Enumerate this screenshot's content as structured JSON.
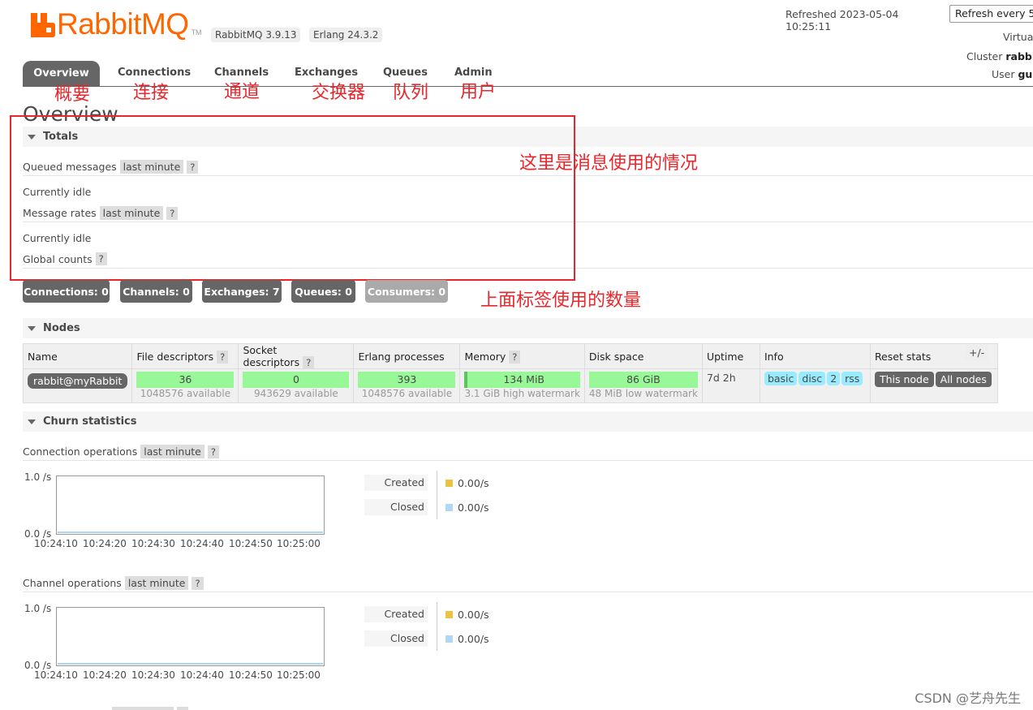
{
  "header": {
    "logo_text": "RabbitMQ",
    "logo_tm": "TM",
    "rabbitmq_version": "RabbitMQ 3.9.13",
    "erlang_version": "Erlang 24.3.2",
    "refreshed": "Refreshed 2023-05-04 10:25:11",
    "refresh_select": "Refresh every 5",
    "virtual_label": "Virtua",
    "cluster_label": "Cluster",
    "cluster_value": "rabbi",
    "user_label": "User",
    "user_value": "gu"
  },
  "tabs": [
    {
      "label": "Overview",
      "annotation": "概要"
    },
    {
      "label": "Connections",
      "annotation": "连接"
    },
    {
      "label": "Channels",
      "annotation": "通道"
    },
    {
      "label": "Exchanges",
      "annotation": "交换器"
    },
    {
      "label": "Queues",
      "annotation": "队列"
    },
    {
      "label": "Admin",
      "annotation": "用户"
    }
  ],
  "page_title": "Overview",
  "totals": {
    "header": "Totals",
    "queued_messages": "Queued messages",
    "last_minute": "last minute",
    "help": "?",
    "currently_idle": "Currently idle",
    "message_rates": "Message rates",
    "global_counts": "Global counts"
  },
  "annotations": {
    "totals_note": "这里是消息使用的情况",
    "counts_note": "上面标签使用的数量"
  },
  "counts": [
    {
      "label": "Connections: 0"
    },
    {
      "label": "Channels: 0"
    },
    {
      "label": "Exchanges: 7"
    },
    {
      "label": "Queues: 0"
    },
    {
      "label": "Consumers: 0"
    }
  ],
  "nodes": {
    "header": "Nodes",
    "columns": [
      "Name",
      "File descriptors",
      "Socket descriptors",
      "Erlang processes",
      "Memory",
      "Disk space",
      "Uptime",
      "Info",
      "Reset stats"
    ],
    "help": "?",
    "plus_minus": "+/-",
    "row": {
      "name": "rabbit@myRabbit",
      "file_desc": "36",
      "file_desc_avail": "1048576 available",
      "socket_desc": "0",
      "socket_desc_avail": "943629 available",
      "erlang_proc": "393",
      "erlang_proc_avail": "1048576 available",
      "memory": "134 MiB",
      "memory_sub": "3.1 GiB high watermark",
      "disk": "86 GiB",
      "disk_sub": "48 MiB low watermark",
      "uptime": "7d 2h",
      "info_tags": [
        "basic",
        "disc",
        "2",
        "rss"
      ],
      "reset_this": "This node",
      "reset_all": "All nodes"
    }
  },
  "churn": {
    "header": "Churn statistics",
    "connection_ops": "Connection operations",
    "channel_ops": "Channel operations",
    "last_minute": "last minute",
    "help": "?",
    "y_top": "1.0 /s",
    "y_bottom": "0.0 /s",
    "x_ticks": [
      "10:24:10",
      "10:24:20",
      "10:24:30",
      "10:24:40",
      "10:24:50",
      "10:25:00"
    ],
    "legend": [
      {
        "name": "Created",
        "value": "0.00/s",
        "color": "#edc240"
      },
      {
        "name": "Closed",
        "value": "0.00/s",
        "color": "#afd8f8"
      }
    ]
  },
  "watermark": "CSDN @艺舟先生",
  "colors": {
    "accent": "#ff6600",
    "annotation_red": "#e8262b",
    "bar_green": "#98f898",
    "tag_blue": "#99ebff"
  }
}
